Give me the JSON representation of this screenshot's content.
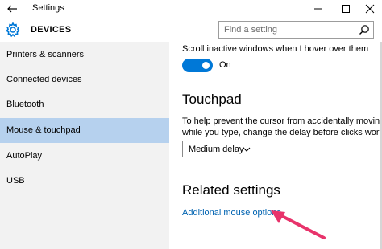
{
  "window": {
    "title": "Settings"
  },
  "header": {
    "title": "DEVICES",
    "icon": "gear-icon"
  },
  "search": {
    "placeholder": "Find a setting"
  },
  "sidebar": {
    "items": [
      {
        "label": "Printers & scanners",
        "selected": false
      },
      {
        "label": "Connected devices",
        "selected": false
      },
      {
        "label": "Bluetooth",
        "selected": false
      },
      {
        "label": "Mouse & touchpad",
        "selected": true
      },
      {
        "label": "AutoPlay",
        "selected": false
      },
      {
        "label": "USB",
        "selected": false
      }
    ]
  },
  "main": {
    "scroll_inactive": {
      "label": "Scroll inactive windows when I hover over them",
      "toggle_state": "On",
      "toggle_on": true
    },
    "touchpad": {
      "title": "Touchpad",
      "description_line1": "To help prevent the cursor from accidentally moving",
      "description_line2": "while you type, change the delay before clicks work.",
      "delay_value": "Medium delay"
    },
    "related": {
      "title": "Related settings",
      "link": "Additional mouse options"
    }
  },
  "colors": {
    "accent": "#0078d7",
    "selected_bg": "#b6d1ee",
    "sidebar_bg": "#f2f2f2",
    "link": "#0063b1",
    "annotation_arrow": "#e8336b"
  }
}
